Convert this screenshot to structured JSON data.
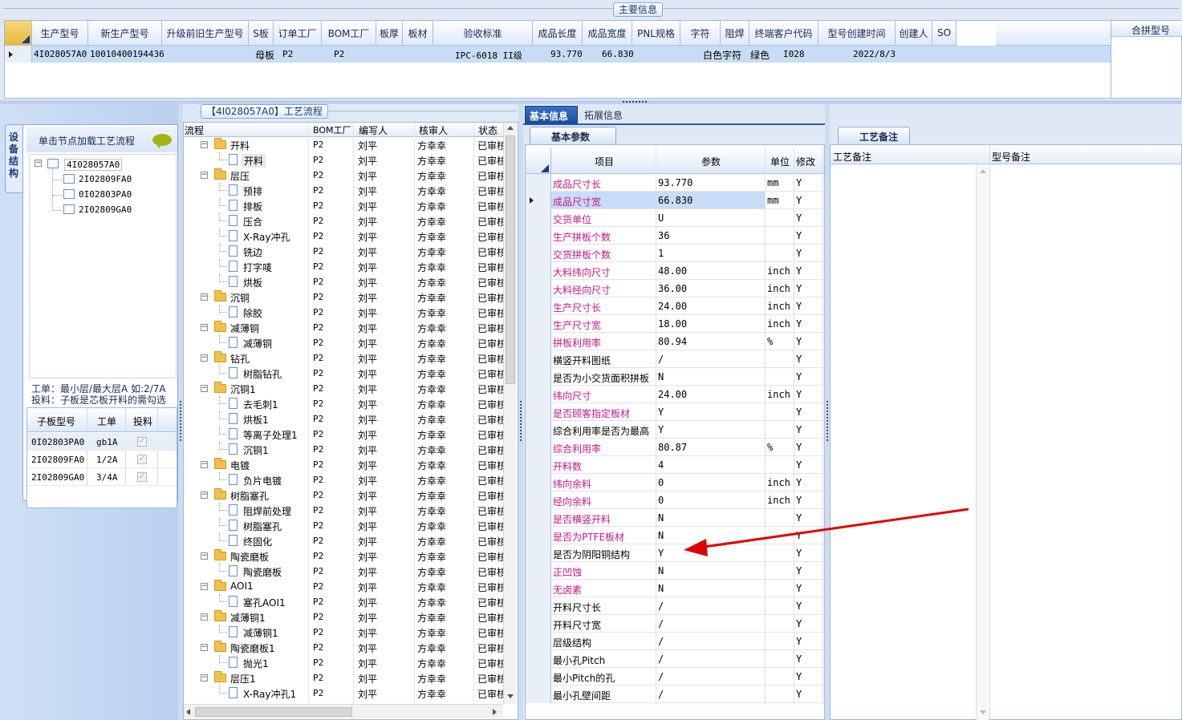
{
  "top_section": {
    "title": "主要信息",
    "columns": [
      "生产型号",
      "新生产型号",
      "升级前旧生产型号",
      "S板",
      "订单工厂",
      "BOM工厂",
      "板厚",
      "板材",
      "验收标准",
      "成品长度",
      "成品宽度",
      "PNL规格",
      "字符",
      "阻焊",
      "终端客户代码",
      "型号创建时间",
      "创建人",
      "SO"
    ],
    "row": {
      "prod_model": "4I028057A0",
      "new_model": "10010400194436",
      "old_model": "",
      "s_board": "母板",
      "order_factory": "P2",
      "bom_factory": "P2",
      "thickness": "",
      "material": "",
      "standard": "IPC-6018 II级",
      "length": "93.770",
      "width": "66.830",
      "pnl": "",
      "char": "白色字符",
      "mask": "绿色",
      "customer_code": "I028",
      "created": "2022/8/3",
      "creator": "",
      "so": ""
    },
    "merge_model_label": "合拼型号"
  },
  "left_panel": {
    "side_tab": "设备结构",
    "hint": "单击节点加载工艺流程",
    "tree_root": "4I028057A0",
    "tree_children": [
      "2I02809FA0",
      "0I02803PA0",
      "2I02809GA0"
    ],
    "notes": [
      "工单：最小层/最大层A 如:2/7A",
      "投料：子板是芯板开料的需勾选"
    ],
    "sub_table": {
      "headers": [
        "子板型号",
        "工单",
        "投料"
      ],
      "rows": [
        {
          "model": "0I02803PA0",
          "order": "gb1A"
        },
        {
          "model": "2I02809FA0",
          "order": "1/2A"
        },
        {
          "model": "2I02809GA0",
          "order": "3/4A"
        }
      ]
    }
  },
  "process_panel": {
    "title": "【4I028057A0】工艺流程",
    "headers": [
      "流程",
      "BOM工厂",
      "编写人",
      "核审人",
      "状态"
    ],
    "rows": [
      {
        "level": 0,
        "name": "开料",
        "bom": "P2",
        "writer": "刘平",
        "reviewer": "方幸幸",
        "status": "已审核"
      },
      {
        "level": 1,
        "name": "开料",
        "bom": "P2",
        "writer": "刘平",
        "reviewer": "方幸幸",
        "status": "已审核"
      },
      {
        "level": 0,
        "name": "层压",
        "bom": "P2",
        "writer": "刘平",
        "reviewer": "方幸幸",
        "status": "已审核"
      },
      {
        "level": 1,
        "name": "预排",
        "bom": "P2",
        "writer": "刘平",
        "reviewer": "方幸幸",
        "status": "已审核"
      },
      {
        "level": 1,
        "name": "排板",
        "bom": "P2",
        "writer": "刘平",
        "reviewer": "方幸幸",
        "status": "已审核"
      },
      {
        "level": 1,
        "name": "压合",
        "bom": "P2",
        "writer": "刘平",
        "reviewer": "方幸幸",
        "status": "已审核"
      },
      {
        "level": 1,
        "name": "X-Ray冲孔",
        "bom": "P2",
        "writer": "刘平",
        "reviewer": "方幸幸",
        "status": "已审核"
      },
      {
        "level": 1,
        "name": "铣边",
        "bom": "P2",
        "writer": "刘平",
        "reviewer": "方幸幸",
        "status": "已审核"
      },
      {
        "level": 1,
        "name": "打字唛",
        "bom": "P2",
        "writer": "刘平",
        "reviewer": "方幸幸",
        "status": "已审核"
      },
      {
        "level": 1,
        "name": "烘板",
        "bom": "P2",
        "writer": "刘平",
        "reviewer": "方幸幸",
        "status": "已审核"
      },
      {
        "level": 0,
        "name": "沉铜",
        "bom": "P2",
        "writer": "刘平",
        "reviewer": "方幸幸",
        "status": "已审核"
      },
      {
        "level": 1,
        "name": "除胶",
        "bom": "P2",
        "writer": "刘平",
        "reviewer": "方幸幸",
        "status": "已审核"
      },
      {
        "level": 0,
        "name": "减薄铜",
        "bom": "P2",
        "writer": "刘平",
        "reviewer": "方幸幸",
        "status": "已审核"
      },
      {
        "level": 1,
        "name": "减薄铜",
        "bom": "P2",
        "writer": "刘平",
        "reviewer": "方幸幸",
        "status": "已审核"
      },
      {
        "level": 0,
        "name": "钻孔",
        "bom": "P2",
        "writer": "刘平",
        "reviewer": "方幸幸",
        "status": "已审核"
      },
      {
        "level": 1,
        "name": "树脂钻孔",
        "bom": "P2",
        "writer": "刘平",
        "reviewer": "方幸幸",
        "status": "已审核"
      },
      {
        "level": 0,
        "name": "沉铜1",
        "bom": "P2",
        "writer": "刘平",
        "reviewer": "方幸幸",
        "status": "已审核"
      },
      {
        "level": 1,
        "name": "去毛刺1",
        "bom": "P2",
        "writer": "刘平",
        "reviewer": "方幸幸",
        "status": "已审核"
      },
      {
        "level": 1,
        "name": "烘板1",
        "bom": "P2",
        "writer": "刘平",
        "reviewer": "方幸幸",
        "status": "已审核"
      },
      {
        "level": 1,
        "name": "等离子处理1",
        "bom": "P2",
        "writer": "刘平",
        "reviewer": "方幸幸",
        "status": "已审核"
      },
      {
        "level": 1,
        "name": "沉铜1",
        "bom": "P2",
        "writer": "刘平",
        "reviewer": "方幸幸",
        "status": "已审核"
      },
      {
        "level": 0,
        "name": "电镀",
        "bom": "P2",
        "writer": "刘平",
        "reviewer": "方幸幸",
        "status": "已审核"
      },
      {
        "level": 1,
        "name": "负片电镀",
        "bom": "P2",
        "writer": "刘平",
        "reviewer": "方幸幸",
        "status": "已审核"
      },
      {
        "level": 0,
        "name": "树脂塞孔",
        "bom": "P2",
        "writer": "刘平",
        "reviewer": "方幸幸",
        "status": "已审核"
      },
      {
        "level": 1,
        "name": "阻焊前处理",
        "bom": "P2",
        "writer": "刘平",
        "reviewer": "方幸幸",
        "status": "已审核"
      },
      {
        "level": 1,
        "name": "树脂塞孔",
        "bom": "P2",
        "writer": "刘平",
        "reviewer": "方幸幸",
        "status": "已审核"
      },
      {
        "level": 1,
        "name": "终固化",
        "bom": "P2",
        "writer": "刘平",
        "reviewer": "方幸幸",
        "status": "已审核"
      },
      {
        "level": 0,
        "name": "陶瓷磨板",
        "bom": "P2",
        "writer": "刘平",
        "reviewer": "方幸幸",
        "status": "已审核"
      },
      {
        "level": 1,
        "name": "陶瓷磨板",
        "bom": "P2",
        "writer": "刘平",
        "reviewer": "方幸幸",
        "status": "已审核"
      },
      {
        "level": 0,
        "name": "AOI1",
        "bom": "P2",
        "writer": "刘平",
        "reviewer": "方幸幸",
        "status": "已审核"
      },
      {
        "level": 1,
        "name": "塞孔AOI1",
        "bom": "P2",
        "writer": "刘平",
        "reviewer": "方幸幸",
        "status": "已审核"
      },
      {
        "level": 0,
        "name": "减薄铜1",
        "bom": "P2",
        "writer": "刘平",
        "reviewer": "方幸幸",
        "status": "已审核"
      },
      {
        "level": 1,
        "name": "减薄铜1",
        "bom": "P2",
        "writer": "刘平",
        "reviewer": "方幸幸",
        "status": "已审核"
      },
      {
        "level": 0,
        "name": "陶瓷磨板1",
        "bom": "P2",
        "writer": "刘平",
        "reviewer": "方幸幸",
        "status": "已审核"
      },
      {
        "level": 1,
        "name": "抛光1",
        "bom": "P2",
        "writer": "刘平",
        "reviewer": "方幸幸",
        "status": "已审核"
      },
      {
        "level": 0,
        "name": "层压1",
        "bom": "P2",
        "writer": "刘平",
        "reviewer": "方幸幸",
        "status": "已审核"
      },
      {
        "level": 1,
        "name": "X-Ray冲孔1",
        "bom": "P2",
        "writer": "刘平",
        "reviewer": "方幸幸",
        "status": "已审核"
      }
    ]
  },
  "info_panel": {
    "tabs": [
      "基本信息",
      "拓展信息"
    ],
    "sub_tab": "基本参数",
    "headers": [
      "项目",
      "参数",
      "单位",
      "修改"
    ],
    "rows": [
      {
        "item": "成品尺寸长",
        "value": "93.770",
        "unit": "mm",
        "mod": "Y",
        "magenta": true
      },
      {
        "item": "成品尺寸宽",
        "value": "66.830",
        "unit": "mm",
        "mod": "Y",
        "magenta": true,
        "selected": true
      },
      {
        "item": "交货单位",
        "value": "U",
        "unit": "",
        "mod": "Y",
        "magenta": true
      },
      {
        "item": "生产拼板个数",
        "value": "36",
        "unit": "",
        "mod": "Y",
        "magenta": true
      },
      {
        "item": "交货拼板个数",
        "value": "1",
        "unit": "",
        "mod": "Y",
        "magenta": true
      },
      {
        "item": "大料纬向尺寸",
        "value": "48.00",
        "unit": "inch",
        "mod": "Y",
        "magenta": true
      },
      {
        "item": "大料经向尺寸",
        "value": "36.00",
        "unit": "inch",
        "mod": "Y",
        "magenta": true
      },
      {
        "item": "生产尺寸长",
        "value": "24.00",
        "unit": "inch",
        "mod": "Y",
        "magenta": true
      },
      {
        "item": "生产尺寸宽",
        "value": "18.00",
        "unit": "inch",
        "mod": "Y",
        "magenta": true
      },
      {
        "item": "拼板利用率",
        "value": "80.94",
        "unit": "%",
        "mod": "Y",
        "magenta": true
      },
      {
        "item": "横竖开料图纸",
        "value": "/",
        "unit": "",
        "mod": "Y",
        "magenta": false
      },
      {
        "item": "是否为小交货面积拼板",
        "value": "N",
        "unit": "",
        "mod": "Y",
        "magenta": false
      },
      {
        "item": "纬向尺寸",
        "value": "24.00",
        "unit": "inch",
        "mod": "Y",
        "magenta": true
      },
      {
        "item": "是否顾客指定板材",
        "value": "Y",
        "unit": "",
        "mod": "Y",
        "magenta": true
      },
      {
        "item": "综合利用率是否为最高",
        "value": "Y",
        "unit": "",
        "mod": "Y",
        "magenta": false
      },
      {
        "item": "综合利用率",
        "value": "80.87",
        "unit": "%",
        "mod": "Y",
        "magenta": true
      },
      {
        "item": "开料数",
        "value": "4",
        "unit": "",
        "mod": "Y",
        "magenta": true
      },
      {
        "item": "纬向余料",
        "value": "0",
        "unit": "inch",
        "mod": "Y",
        "magenta": true
      },
      {
        "item": "经向余料",
        "value": "0",
        "unit": "inch",
        "mod": "Y",
        "magenta": true
      },
      {
        "item": "是否横竖开料",
        "value": "N",
        "unit": "",
        "mod": "Y",
        "magenta": true
      },
      {
        "item": "是否为PTFE板材",
        "value": "N",
        "unit": "",
        "mod": "Y",
        "magenta": true
      },
      {
        "item": "是否为阴阳铜结构",
        "value": "Y",
        "unit": "",
        "mod": "Y",
        "magenta": false
      },
      {
        "item": "正凹蚀",
        "value": "N",
        "unit": "",
        "mod": "Y",
        "magenta": true
      },
      {
        "item": "无卤素",
        "value": "N",
        "unit": "",
        "mod": "Y",
        "magenta": true
      },
      {
        "item": "开料尺寸长",
        "value": "/",
        "unit": "",
        "mod": "Y",
        "magenta": false
      },
      {
        "item": "开料尺寸宽",
        "value": "/",
        "unit": "",
        "mod": "Y",
        "magenta": false
      },
      {
        "item": "层级结构",
        "value": "/",
        "unit": "",
        "mod": "Y",
        "magenta": false
      },
      {
        "item": "最小孔Pitch",
        "value": "/",
        "unit": "",
        "mod": "Y",
        "magenta": false
      },
      {
        "item": "最小Pitch的孔",
        "value": "/",
        "unit": "",
        "mod": "Y",
        "magenta": false
      },
      {
        "item": "最小孔壁间距",
        "value": "/",
        "unit": "",
        "mod": "Y",
        "magenta": false
      }
    ]
  },
  "remarks_panel": {
    "title": "工艺备注",
    "columns": [
      "工艺备注",
      "型号备注"
    ]
  },
  "colors": {
    "panel_blue": "#cfdff4",
    "selected_row": "#c7dcf5",
    "magenta": "#c71585",
    "arrow": "#e00000"
  }
}
